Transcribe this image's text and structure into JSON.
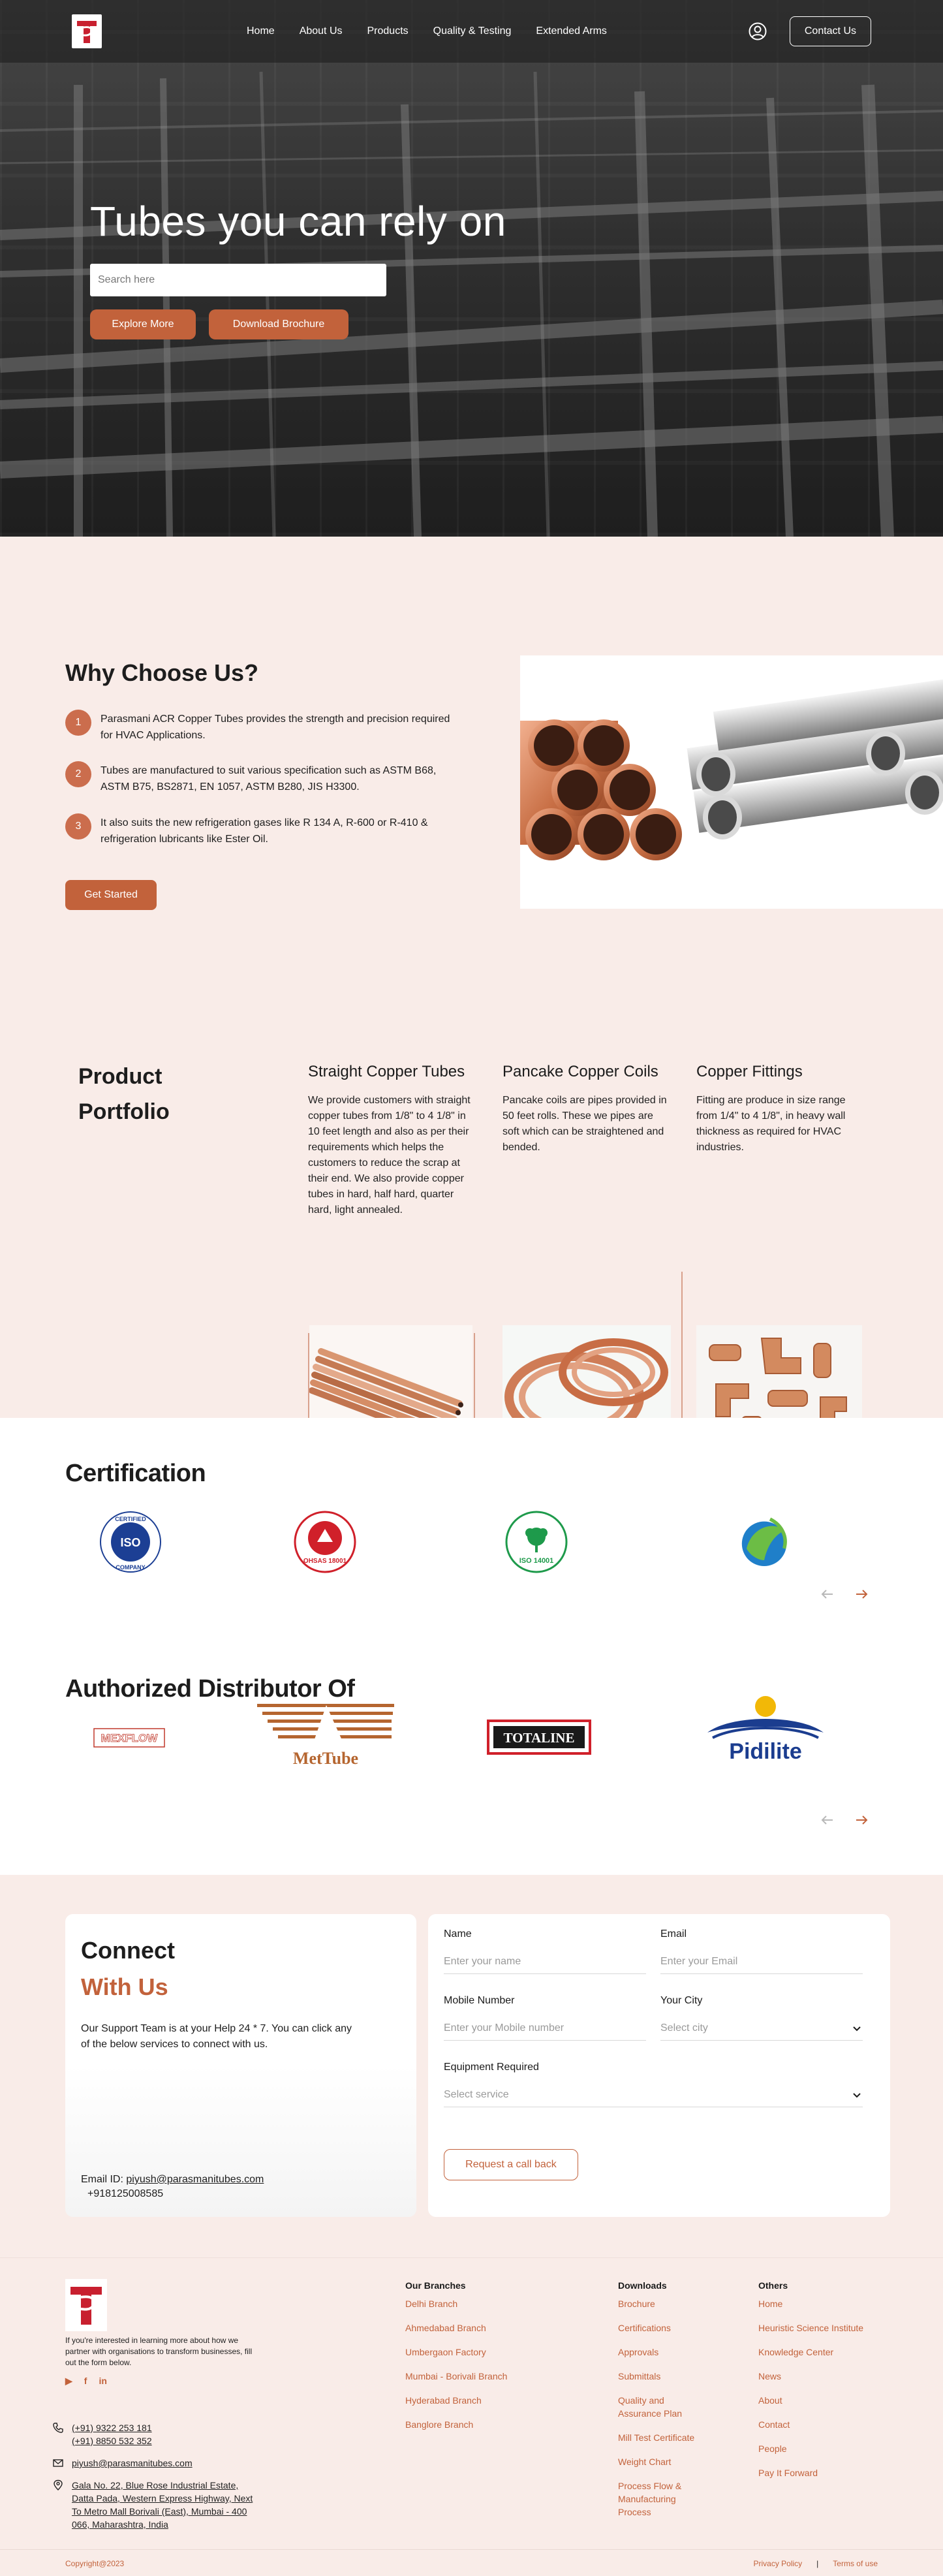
{
  "nav": {
    "links": [
      "Home",
      "About Us",
      "Products",
      "Quality & Testing",
      "Extended Arms"
    ],
    "contact_label": "Contact Us"
  },
  "hero": {
    "title": "Tubes you can rely on",
    "search_placeholder": "Search here",
    "btn_explore": "Explore More",
    "btn_brochure": "Download Brochure"
  },
  "why": {
    "title": "Why Choose Us?",
    "items": [
      {
        "num": "1",
        "text": "Parasmani ACR Copper Tubes provides the strength and precision required for HVAC Applications."
      },
      {
        "num": "2",
        "text": "Tubes are manufactured to suit various specification such as ASTM B68, ASTM B75, BS2871, EN 1057, ASTM B280, JIS H3300."
      },
      {
        "num": "3",
        "text": "It also suits the new refrigeration gases like R 134 A, R-600 or R-410 & refrigeration lubricants like Ester Oil."
      }
    ],
    "cta": "Get Started"
  },
  "portfolio": {
    "title": "Product Portfolio",
    "products": [
      {
        "title": "Straight Copper Tubes",
        "desc": "We provide customers with straight copper tubes from 1/8\" to 4 1/8\" in 10 feet length and also as per their requirements which helps the customers to reduce the scrap at their end. We also provide copper tubes in hard, half hard, quarter hard, light annealed."
      },
      {
        "title": "Pancake Copper Coils",
        "desc": "Pancake coils are pipes provided in 50 feet rolls. These we pipes are soft which can be straightened and bended."
      },
      {
        "title": "Copper Fittings",
        "desc": "Fitting are produce in size range from 1/4\" to 4 1/8\", in heavy wall thickness as required for HVAC industries."
      }
    ]
  },
  "certification": {
    "title": "Certification",
    "badges": {
      "iso_top": "CERTIFIED",
      "iso_mid": "ISO",
      "iso_bottom": "COMPANY",
      "ohsas": "OHSAS 18001",
      "iso14001": "ISO 14001"
    }
  },
  "distributor": {
    "title": "Authorized Distributor Of",
    "brands": {
      "mexflow": "MEXFLOW",
      "mettube": "MetTube",
      "totaline": "TOTALINE",
      "pidilite": "Pidilite"
    }
  },
  "connect": {
    "title_1": "Connect",
    "title_2": "With Us",
    "desc": "Our Support Team is at your Help 24 * 7. You can click any of the below services to connect with us.",
    "email_label": "Email ID:",
    "email": "piyush@parasmanitubes.com",
    "phone": "+918125008585",
    "form": {
      "name_label": "Name",
      "name_placeholder": "Enter your name",
      "email_label": "Email",
      "email_placeholder": "Enter your Email",
      "mobile_label": "Mobile Number",
      "mobile_placeholder": "Enter your Mobile number",
      "city_label": "Your City",
      "city_placeholder": "Select city",
      "equipment_label": "Equipment Required",
      "equipment_placeholder": "Select service",
      "submit": "Request a call back"
    }
  },
  "footer": {
    "about": "If you're interested in learning more about how we partner with organisations to transform businesses, fill out the form below.",
    "social": [
      "▶",
      "f",
      "in"
    ],
    "phones": [
      "(+91) 9322 253 181",
      "(+91) 8850 532 352"
    ],
    "email": "piyush@parasmanitubes.com",
    "address": "Gala No. 22, Blue Rose Industrial Estate, Datta Pada, Western Express Highway, Next To Metro Mall Borivali (East), Mumbai - 400 066, Maharashtra, India",
    "branches_title": "Our Branches",
    "branches": [
      "Delhi Branch",
      "Ahmedabad Branch",
      "Umbergaon Factory",
      "Mumbai - Borivali Branch",
      "Hyderabad Branch",
      "Banglore Branch"
    ],
    "downloads_title": "Downloads",
    "downloads": [
      "Brochure",
      "Certifications",
      "Approvals",
      "Submittals",
      "Quality and Assurance Plan",
      "Mill Test Certificate",
      "Weight Chart",
      "Process Flow & Manufacturing Process"
    ],
    "others_title": "Others",
    "others": [
      "Home",
      "Heuristic Science Institute",
      "Knowledge Center",
      "News",
      "About",
      "Contact",
      "People",
      "Pay It Forward"
    ],
    "copyright": "Copyright@2023",
    "privacy": "Privacy Policy",
    "separator": "|",
    "terms": "Terms of use"
  },
  "colors": {
    "accent": "#c2623b",
    "section_bg": "#f9ece8",
    "logo_red": "#c8202f"
  }
}
